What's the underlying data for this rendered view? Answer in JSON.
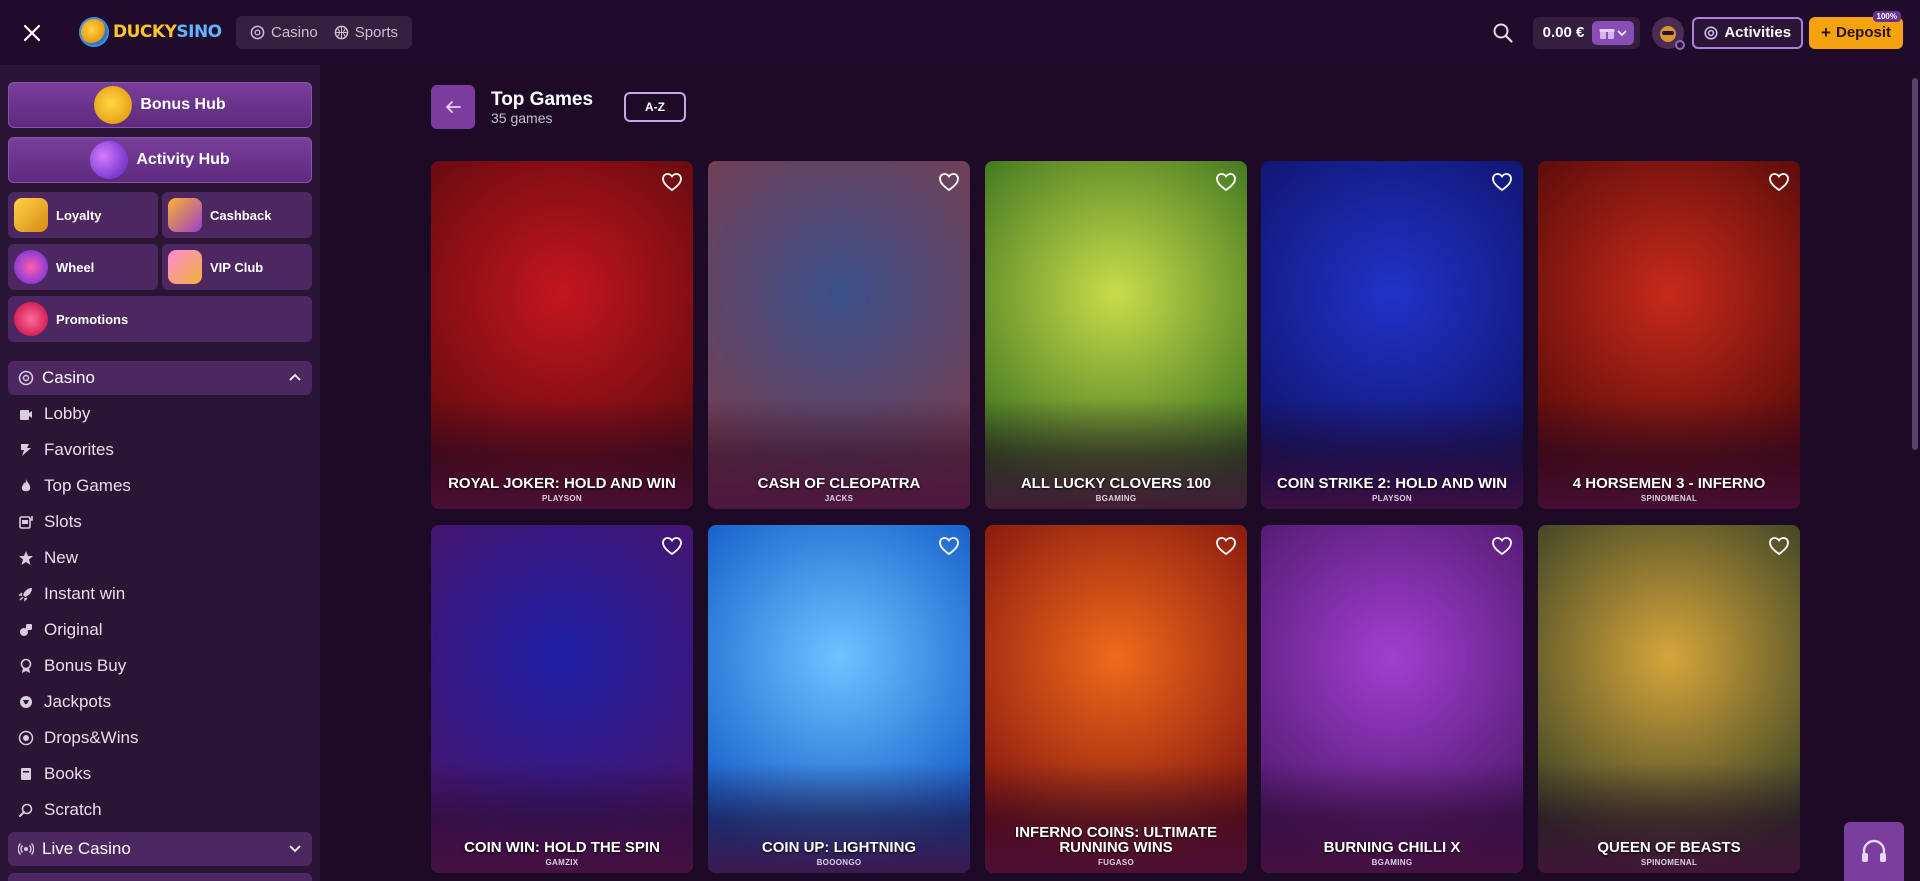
{
  "header": {
    "logo_text_1": "DUCKY",
    "logo_text_2": "SINO",
    "nav": [
      {
        "label": "Casino",
        "icon": "casino-chip-icon"
      },
      {
        "label": "Sports",
        "icon": "basketball-icon"
      }
    ],
    "balance": "0.00 €",
    "activities_label": "Activities",
    "deposit_label": "Deposit",
    "deposit_tag": "100%"
  },
  "sidebar": {
    "bonus_hub": "Bonus Hub",
    "activity_hub": "Activity Hub",
    "tiles": [
      {
        "label": "Loyalty",
        "icon": "loyalty-duck-icon"
      },
      {
        "label": "Cashback",
        "icon": "cashback-icon"
      },
      {
        "label": "Wheel",
        "icon": "wheel-icon"
      },
      {
        "label": "VIP Club",
        "icon": "vip-icon"
      },
      {
        "label": "Promotions",
        "icon": "promotions-icon"
      }
    ],
    "casino_header": "Casino",
    "menu": [
      {
        "label": "Lobby",
        "icon": "lobby-icon"
      },
      {
        "label": "Favorites",
        "icon": "favorites-icon"
      },
      {
        "label": "Top Games",
        "icon": "flame-icon"
      },
      {
        "label": "Slots",
        "icon": "slots-icon"
      },
      {
        "label": "New",
        "icon": "star-icon"
      },
      {
        "label": "Instant win",
        "icon": "rocket-icon"
      },
      {
        "label": "Original",
        "icon": "original-icon"
      },
      {
        "label": "Bonus Buy",
        "icon": "bonus-buy-icon"
      },
      {
        "label": "Jackpots",
        "icon": "jackpot-icon"
      },
      {
        "label": "Drops&Wins",
        "icon": "drops-icon"
      },
      {
        "label": "Books",
        "icon": "book-icon"
      },
      {
        "label": "Scratch",
        "icon": "scratch-icon"
      }
    ],
    "live_casino_header": "Live Casino"
  },
  "main": {
    "title": "Top Games",
    "count": "35 games",
    "sort_label": "A-Z",
    "games": [
      {
        "name": "ROYAL JOKER: HOLD AND WIN",
        "provider": "PLAYSON",
        "colors": [
          "#c4151f",
          "#5a0a0d"
        ]
      },
      {
        "name": "CASH OF CLEOPATRA",
        "provider": "JACKS",
        "colors": [
          "#3a4f8a",
          "#7a3d4d"
        ]
      },
      {
        "name": "ALL LUCKY CLOVERS 100",
        "provider": "BGAMING",
        "colors": [
          "#c9dc4a",
          "#2f6a1b"
        ]
      },
      {
        "name": "COIN STRIKE 2: HOLD AND WIN",
        "provider": "PLAYSON",
        "colors": [
          "#2232c9",
          "#0d1266"
        ]
      },
      {
        "name": "4 HORSEMEN 3 - INFERNO",
        "provider": "SPINOMENAL",
        "colors": [
          "#c72a1a",
          "#4d0808"
        ]
      },
      {
        "name": "COIN WIN: HOLD THE SPIN",
        "provider": "GAMZIX",
        "colors": [
          "#1e1fa6",
          "#4a1466"
        ]
      },
      {
        "name": "COIN UP: LIGHTNING",
        "provider": "BOOONGO",
        "colors": [
          "#6fc3ff",
          "#0a52c4"
        ]
      },
      {
        "name": "INFERNO COINS: ULTIMATE RUNNING WINS",
        "provider": "FUGASO",
        "colors": [
          "#f06a1a",
          "#7a0e0e"
        ]
      },
      {
        "name": "BURNING CHILLI X",
        "provider": "BGAMING",
        "colors": [
          "#a13fd0",
          "#4a1666"
        ]
      },
      {
        "name": "QUEEN OF BEASTS",
        "provider": "SPINOMENAL",
        "colors": [
          "#d6a53a",
          "#2c3a24"
        ]
      }
    ]
  }
}
